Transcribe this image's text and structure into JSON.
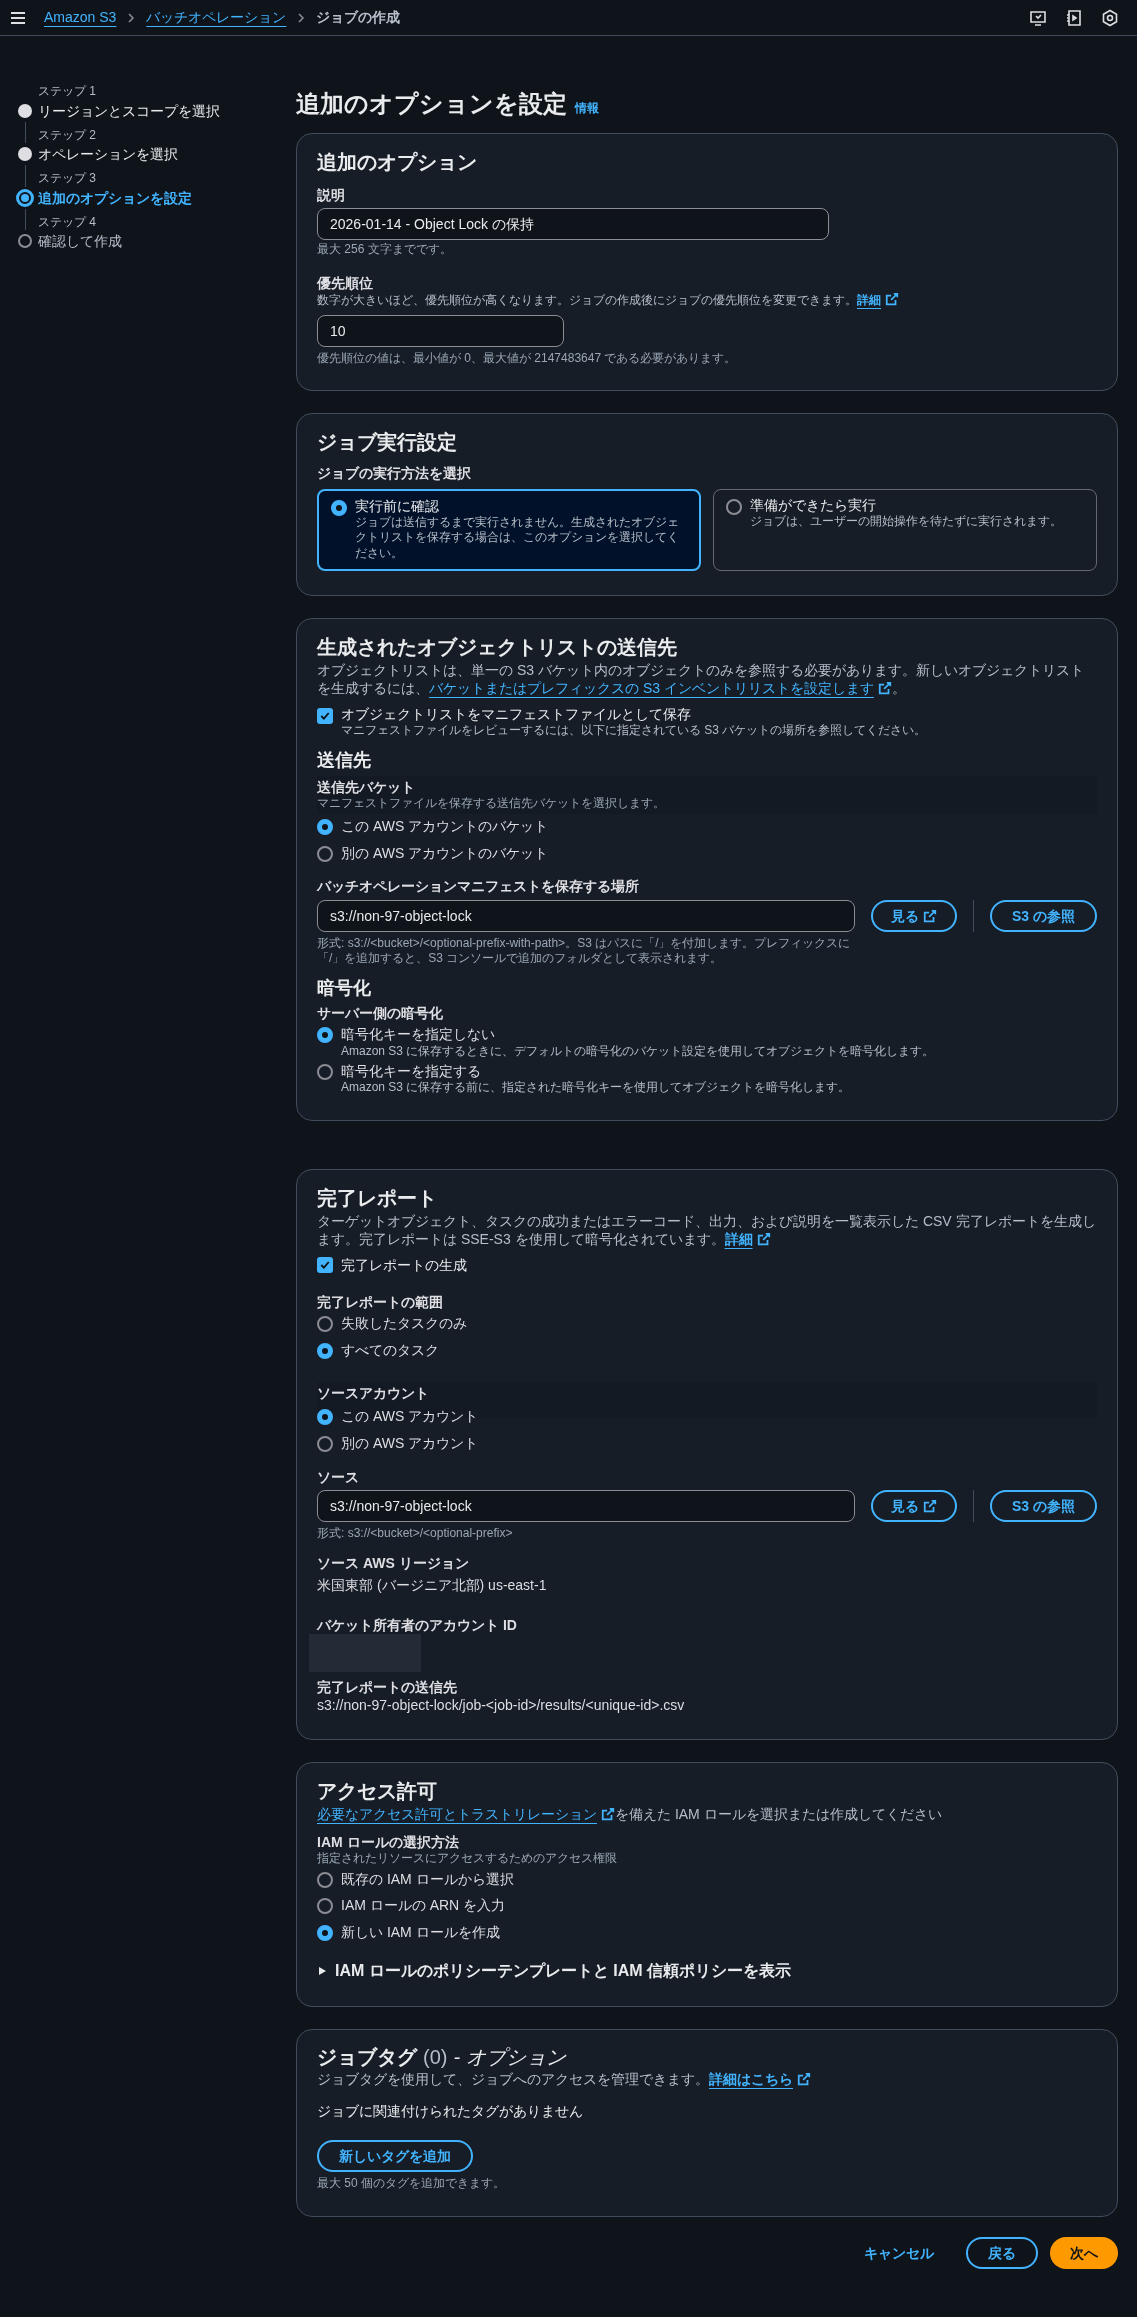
{
  "top_bar": {
    "breadcrumbs": [
      {
        "label": "Amazon S3",
        "link": true
      },
      {
        "label": "バッチオペレーション",
        "link": true
      },
      {
        "label": "ジョブの作成",
        "link": false
      }
    ]
  },
  "steps": [
    {
      "step": "ステップ 1",
      "label": "リージョンとスコープを選択",
      "completed": true,
      "selected": false
    },
    {
      "step": "ステップ 2",
      "label": "オペレーションを選択",
      "completed": true,
      "selected": false
    },
    {
      "step": "ステップ 3",
      "label": "追加のオプションを設定",
      "completed": false,
      "selected": true
    },
    {
      "step": "ステップ 4",
      "label": "確認して作成",
      "completed": false,
      "selected": false
    }
  ],
  "page_title": "追加のオプションを設定",
  "info_link": "情報",
  "options": {
    "title": "追加のオプション",
    "description": {
      "label": "説明",
      "value": "2026-01-14 - Object Lock の保持",
      "hint": "最大 256 文字までです。"
    },
    "priority": {
      "label": "優先順位",
      "help": "数字が大きいほど、優先順位が高くなります。ジョブの作成後にジョブの優先順位を変更できます。",
      "help_link": "詳細",
      "value": "10",
      "hint": "優先順位の値は、最小値が 0、最大値が 2147483647 である必要があります。"
    }
  },
  "run_settings": {
    "title": "ジョブ実行設定",
    "label": "ジョブの実行方法を選択",
    "choices": [
      {
        "label": "実行前に確認",
        "description": "ジョブは送信するまで実行されません。生成されたオブジェクトリストを保存する場合は、このオプションを選択してください。",
        "selected": true
      },
      {
        "label": "準備ができたら実行",
        "description": "ジョブは、ユーザーの開始操作を待たずに実行されます。",
        "selected": false
      }
    ]
  },
  "object_list": {
    "title": "生成されたオブジェクトリストの送信先",
    "text": "オブジェクトリストは、単一の S3 バケット内のオブジェクトのみを参照する必要があります。新しいオブジェクトリストを生成するには、",
    "link": "バケットまたはプレフィックスの S3 インベントリリストを設定します",
    "text_end": "。",
    "save_manifest": {
      "label": "オブジェクトリストをマニフェストファイルとして保存",
      "description": "マニフェストファイルをレビューするには、以下に指定されている S3 バケットの場所を参照してください。",
      "checked": true
    },
    "destination_title": "送信先",
    "bucket": {
      "label": "送信先バケット",
      "description": "マニフェストファイルを保存する送信先バケットを選択します。",
      "options": [
        {
          "label": "この AWS アカウントのバケット",
          "selected": true
        },
        {
          "label": "別の AWS アカウントのバケット",
          "selected": false
        }
      ]
    },
    "location": {
      "label": "バッチオペレーションマニフェストを保存する場所",
      "value": "s3://non-97-object-lock",
      "hint": "形式: s3://<bucket>/<optional-prefix-with-path>。S3 はパスに「/」を付加します。プレフィックスに「/」を追加すると、S3 コンソールで追加のフォルダとして表示されます。",
      "view_button": "見る",
      "browse_button": "S3 の参照"
    },
    "encryption_title": "暗号化",
    "encryption": {
      "label": "サーバー側の暗号化",
      "options": [
        {
          "label": "暗号化キーを指定しない",
          "description": "Amazon S3 に保存するときに、デフォルトの暗号化のバケット設定を使用してオブジェクトを暗号化します。",
          "selected": true
        },
        {
          "label": "暗号化キーを指定する",
          "description": "Amazon S3 に保存する前に、指定された暗号化キーを使用してオブジェクトを暗号化します。",
          "selected": false
        }
      ]
    }
  },
  "completion_report": {
    "title": "完了レポート",
    "text": "ターゲットオブジェクト、タスクの成功またはエラーコード、出力、および説明を一覧表示した CSV 完了レポートを生成します。完了レポートは SSE-S3 を使用して暗号化されています。",
    "link": "詳細",
    "generate": {
      "label": "完了レポートの生成",
      "checked": true
    },
    "scope": {
      "label": "完了レポートの範囲",
      "options": [
        {
          "label": "失敗したタスクのみ",
          "selected": false
        },
        {
          "label": "すべてのタスク",
          "selected": true
        }
      ]
    },
    "source_account": {
      "label": "ソースアカウント",
      "options": [
        {
          "label": "この AWS アカウント",
          "selected": true
        },
        {
          "label": "別の AWS アカウント",
          "selected": false
        }
      ]
    },
    "source": {
      "label": "ソース",
      "value": "s3://non-97-object-lock",
      "hint": "形式: s3://<bucket>/<optional-prefix>",
      "view_button": "見る",
      "browse_button": "S3 の参照"
    },
    "region": {
      "label": "ソース AWS リージョン",
      "value": "米国東部 (バージニア北部) us-east-1"
    },
    "owner": {
      "label": "バケット所有者のアカウント ID"
    },
    "destination": {
      "label": "完了レポートの送信先",
      "value": "s3://non-97-object-lock/job-<job-id>/results/<unique-id>.csv"
    }
  },
  "permissions": {
    "title": "アクセス許可",
    "link": "必要なアクセス許可とトラストリレーション",
    "text": "を備えた IAM ロールを選択または作成してください",
    "role": {
      "label": "IAM ロールの選択方法",
      "description": "指定されたリソースにアクセスするためのアクセス権限",
      "options": [
        {
          "label": "既存の IAM ロールから選択",
          "selected": false
        },
        {
          "label": "IAM ロールの ARN を入力",
          "selected": false
        },
        {
          "label": "新しい IAM ロールを作成",
          "selected": true
        }
      ]
    },
    "policy_toggle": {
      "label": "IAM ロールのポリシーテンプレートと IAM 信頼ポリシーを表示",
      "expanded": false
    }
  },
  "job_tags": {
    "title": "ジョブタグ",
    "count": "(0)",
    "suffix": "- オプション",
    "text": "ジョブタグを使用して、ジョブへのアクセスを管理できます。",
    "link": "詳細はこちら",
    "empty": "ジョブに関連付けられたタグがありません",
    "add_button": "新しいタグを追加",
    "hint": "最大 50 個のタグを追加できます。"
  },
  "footer": {
    "cancel": "キャンセル",
    "back": "戻る",
    "next": "次へ"
  }
}
